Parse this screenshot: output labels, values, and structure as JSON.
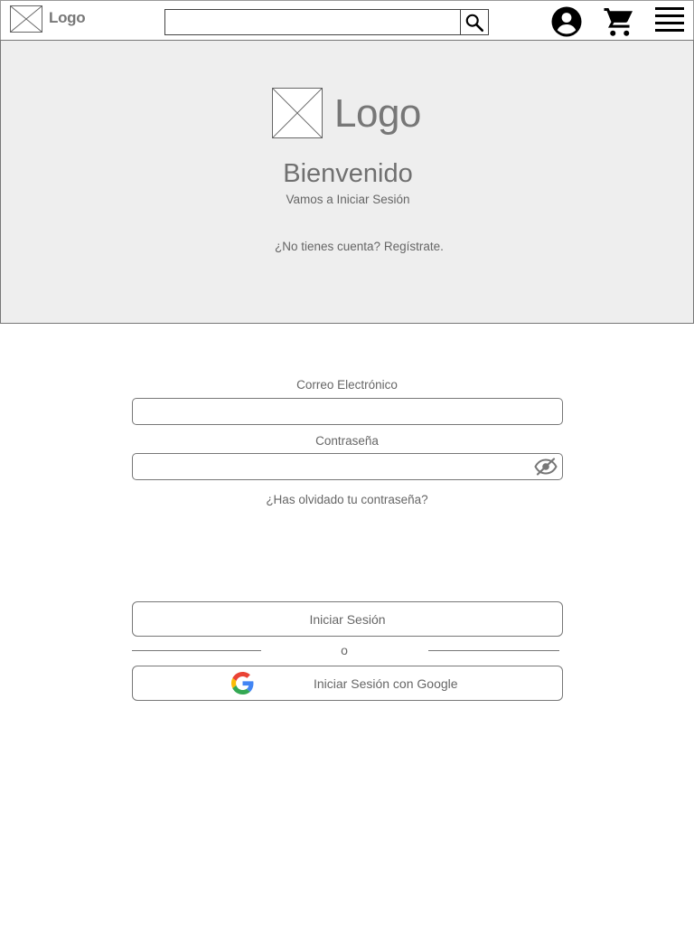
{
  "header": {
    "logo_text": "Logo",
    "search": {
      "value": "",
      "placeholder": ""
    }
  },
  "icons": {
    "search": "search-icon",
    "user": "account-circle-icon",
    "cart": "shopping-cart-icon",
    "menu": "hamburger-menu-icon",
    "password_toggle": "eye-off-icon",
    "google": "google-logo-icon"
  },
  "hero": {
    "logo_text": "Logo",
    "title": "Bienvenido",
    "subtitle": "Vamos a Iniciar Sesión",
    "register_link": "¿No tienes cuenta? Regístrate."
  },
  "form": {
    "email_label": "Correo Electrónico",
    "email_value": "",
    "password_label": "Contraseña",
    "password_value": "",
    "forgot_link": "¿Has olvidado tu contraseña?",
    "login_button": "Iniciar Sesión",
    "divider_text": "o",
    "google_button": "Iniciar Sesión con Google"
  },
  "colors": {
    "hero_background": "#eeeeee",
    "text": "#666666",
    "border": "#777777",
    "icon": "#000000",
    "google_blue": "#4285F4",
    "google_red": "#EA4335",
    "google_yellow": "#FBBC05",
    "google_green": "#34A853"
  }
}
